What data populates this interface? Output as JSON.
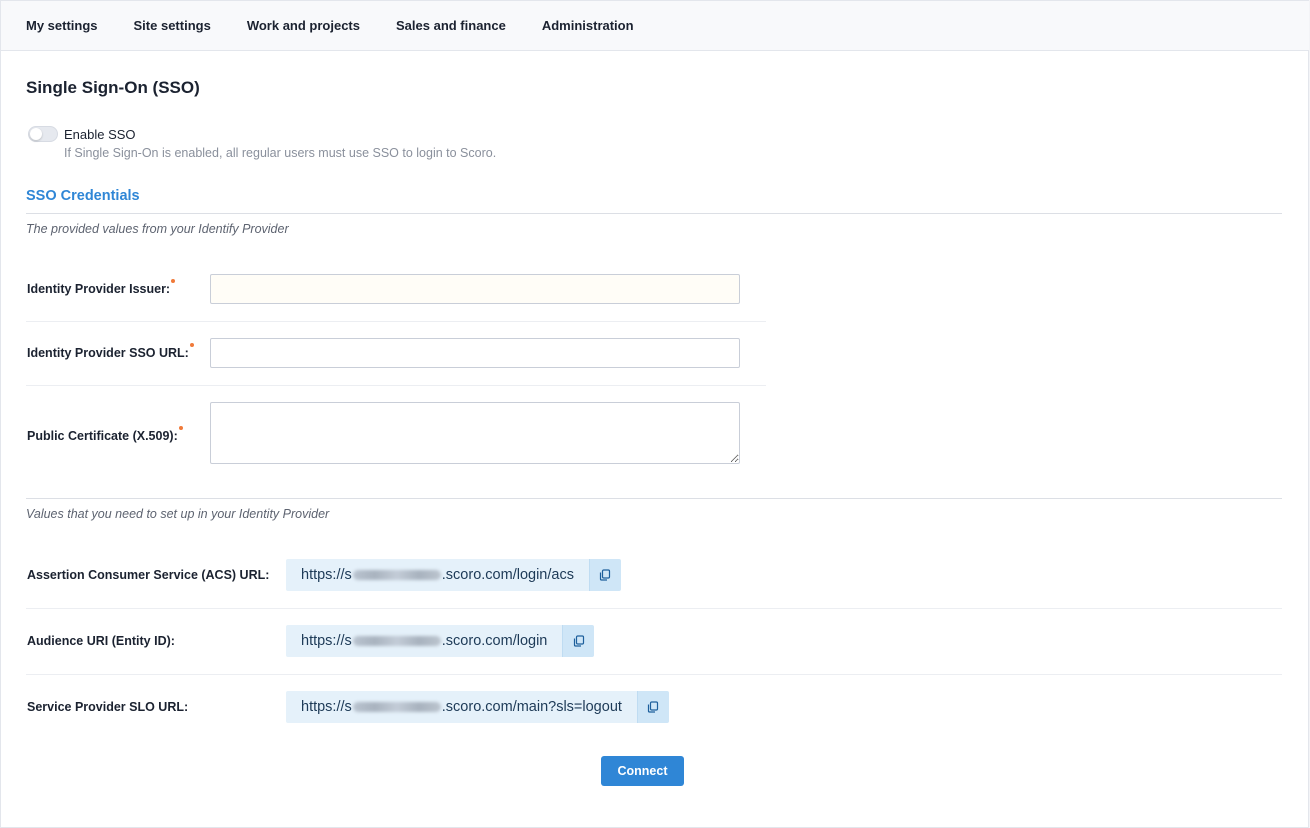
{
  "nav": {
    "items": [
      {
        "label": "My settings"
      },
      {
        "label": "Site settings"
      },
      {
        "label": "Work and projects"
      },
      {
        "label": "Sales and finance"
      },
      {
        "label": "Administration"
      }
    ]
  },
  "page": {
    "title": "Single Sign-On (SSO)"
  },
  "sso_toggle": {
    "label": "Enable SSO",
    "enabled": false,
    "help": "If Single Sign-On is enabled, all regular users must use SSO to login to Scoro."
  },
  "credentials": {
    "section_title": "SSO Credentials",
    "hint": "The provided values from your Identify Provider",
    "fields": [
      {
        "label": "Identity Provider Issuer:",
        "value": "",
        "required": true
      },
      {
        "label": "Identity Provider SSO URL:",
        "value": "",
        "required": true
      },
      {
        "label": "Public Certificate (X.509):",
        "value": "",
        "required": true
      }
    ]
  },
  "provider_values": {
    "hint": "Values that you need to set up in your Identity Provider",
    "rows": [
      {
        "label": "Assertion Consumer Service (ACS) URL:",
        "url_prefix": "https://s",
        "url_suffix": ".scoro.com/login/acs"
      },
      {
        "label": "Audience URI (Entity ID):",
        "url_prefix": "https://s",
        "url_suffix": ".scoro.com/login"
      },
      {
        "label": "Service Provider SLO URL:",
        "url_prefix": "https://s",
        "url_suffix": ".scoro.com/main?sls=logout"
      }
    ]
  },
  "actions": {
    "connect_label": "Connect"
  },
  "colors": {
    "accent": "#2f86d6",
    "required_marker": "#f07a3a",
    "url_background": "#e5f1fa"
  }
}
